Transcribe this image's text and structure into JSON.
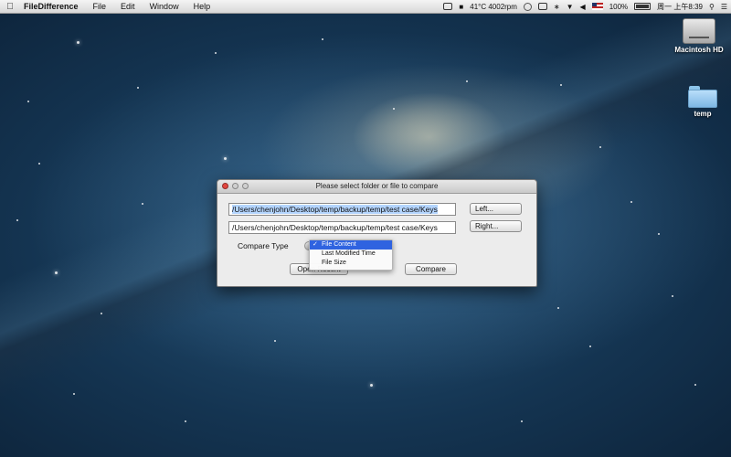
{
  "menubar": {
    "app_name": "FileDifference",
    "items": [
      "File",
      "Edit",
      "Window",
      "Help"
    ],
    "status_temp": "41°C 4002rpm",
    "battery": "100%",
    "datetime": "周一 上午8:39"
  },
  "desktop": {
    "icons": [
      {
        "label": "Macintosh HD",
        "icon": "hard-drive-icon"
      },
      {
        "label": "temp",
        "icon": "folder-icon"
      }
    ]
  },
  "dialog": {
    "title": "Please select folder or file to compare",
    "left_path": "/Users/chenjohn/Desktop/temp/backup/temp/test case/Keys",
    "right_path": "/Users/chenjohn/Desktop/temp/backup/temp/test case/Keys",
    "left_button": "Left...",
    "right_button": "Right...",
    "compare_type_label": "Compare Type",
    "open_recent_button": "Open Recent",
    "compare_button": "Compare"
  },
  "dropdown": {
    "check_mark": "✓",
    "options": [
      "File Content",
      "Last Modified Time",
      "File Size"
    ],
    "selected": "File Content"
  },
  "colors": {
    "selection_blue": "#2f63e0",
    "close_red": "#e2463f"
  }
}
